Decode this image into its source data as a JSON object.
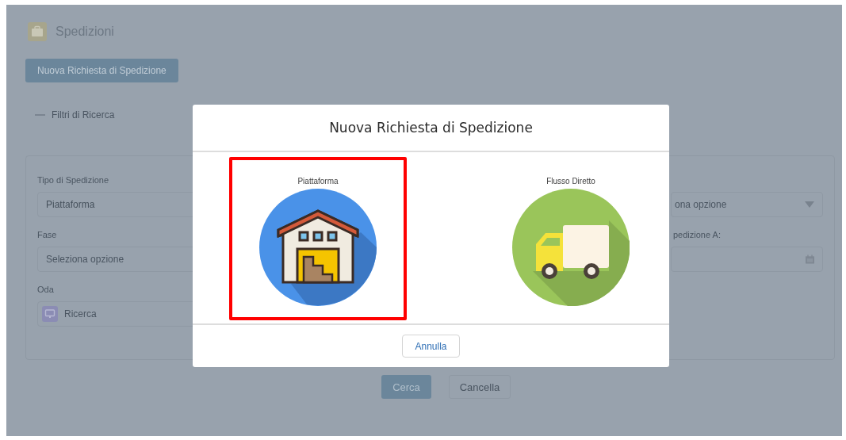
{
  "page": {
    "title": "Spedizioni",
    "new_button": "Nuova Richiesta di Spedizione",
    "filters_toggle": "Filtri di Ricerca",
    "left_fields": [
      {
        "label": "Tipo di Spedizione",
        "value": "Piattaforma",
        "kind": "select"
      },
      {
        "label": "Fase",
        "placeholder": "Seleziona opzione",
        "kind": "select"
      },
      {
        "label": "Oda",
        "placeholder": "Ricerca",
        "kind": "lookup"
      }
    ],
    "right_fields": [
      {
        "placeholder": "ona opzione",
        "kind": "select"
      },
      {
        "label": "pedizione A:",
        "kind": "date"
      }
    ],
    "search_button": "Cerca",
    "clear_button": "Cancella"
  },
  "modal": {
    "title": "Nuova Richiesta di Spedizione",
    "options": [
      {
        "label": "Piattaforma",
        "kind": "warehouse",
        "selected": true
      },
      {
        "label": "Flusso Diretto",
        "kind": "truck",
        "selected": false
      }
    ],
    "cancel_button": "Annulla"
  }
}
